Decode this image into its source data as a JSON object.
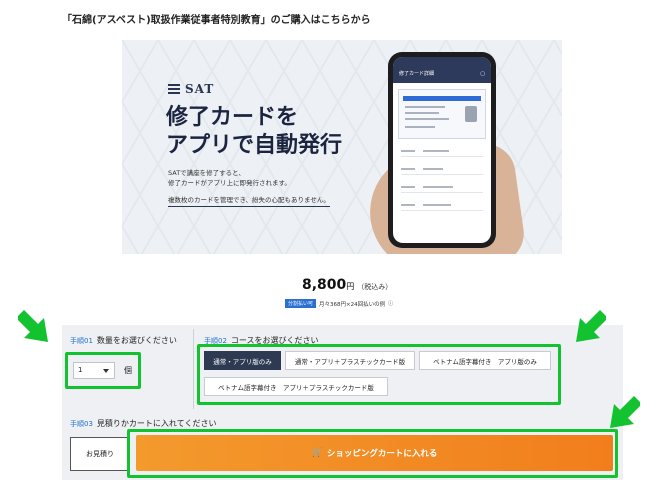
{
  "page": {
    "title": "「石綿(アスベスト)取扱作業従事者特別教育」のご購入はこちらから"
  },
  "banner": {
    "logo": "SAT",
    "headline_line1": "修了カードを",
    "headline_line2": "アプリで自動発行",
    "desc_line1": "SATで講座を修了すると、",
    "desc_line2": "修了カードがアプリ上に即発行されます。",
    "desc_line3": "複数枚のカードを管理でき、紛失の心配もありません。",
    "phone_header": "修了カード詳細"
  },
  "price": {
    "amount": "8,800",
    "yen": "円",
    "tax": "（税込み）",
    "installment_tag": "分割払い可",
    "installment_text": "月々368円×24回払いの例"
  },
  "step1": {
    "num": "手順01",
    "label": "数量をお選びください",
    "qty_value": "1",
    "unit": "個"
  },
  "step2": {
    "num": "手順02",
    "label": "コースをお選びください",
    "options": [
      "通常・アプリ版のみ",
      "通常・アプリ＋プラスチックカード版",
      "ベトナム語字幕付き　アプリ版のみ",
      "ベトナム語字幕付き　アプリ＋プラスチックカード版"
    ]
  },
  "step3": {
    "num": "手順03",
    "label": "見積りかカートに入れてください",
    "estimate_label": "お見積り",
    "cart_label": "ショッピングカートに入れる"
  },
  "colors": {
    "accent_green": "#13c22f",
    "cart_orange": "#f28a24",
    "active_navy": "#2d3a52",
    "step_blue": "#1e6fd0"
  }
}
